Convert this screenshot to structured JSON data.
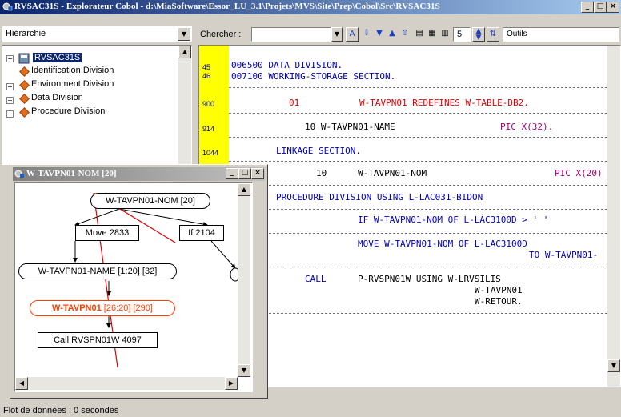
{
  "window": {
    "title": "RVSAC31S - Explorateur Cobol - d:\\MiaSoftware\\Essor_LU_3.1\\Projets\\MVS\\Site\\Prep\\Cobol\\Src\\RVSAC31S",
    "min_label": "_",
    "max_label": "□",
    "close_label": "×"
  },
  "left_panel": {
    "combo_value": "Hiérarchie",
    "tree": {
      "root": "RVSAC31S",
      "items": [
        {
          "label": "Identification Division",
          "expandable": false
        },
        {
          "label": "Environment Division",
          "expandable": true
        },
        {
          "label": "Data Division",
          "expandable": true
        },
        {
          "label": "Procedure Division",
          "expandable": true
        }
      ]
    }
  },
  "toolbar": {
    "search_label": "Chercher :",
    "search_value": "",
    "spin_value": "5",
    "tools_label": "Outils"
  },
  "code": {
    "lines": [
      {
        "ln": "45",
        "text": "006500 DATA DIVISION."
      },
      {
        "ln": "46",
        "text": "007100 WORKING-STORAGE SECTION."
      },
      {
        "ln": "900",
        "text": "01",
        "rest": "W-TAVPN01 REDEFINES W-TABLE-DB2."
      },
      {
        "ln": "914",
        "text": "10 W-TAVPN01-NAME",
        "rest": "PIC X(32)."
      },
      {
        "ln": "1044",
        "text": "LINKAGE SECTION."
      },
      {
        "ln": "",
        "text": "10",
        "rest": "W-TAVPN01-NOM",
        "pic": "PIC X(20)"
      },
      {
        "ln": "",
        "text": "PROCEDURE DIVISION USING L-LAC031-BIDON"
      },
      {
        "ln": "",
        "text": "IF W-TAVPN01-NOM OF L-LAC3100D > ' '"
      },
      {
        "ln": "",
        "text": "MOVE W-TAVPN01-NOM OF L-LAC3100D",
        "rest": "TO W-TAVPN01-"
      },
      {
        "ln": "",
        "text": "CALL",
        "rest": "P-RVSPN01W USING W-LRVSILIS",
        "extra1": "W-TAVPN01",
        "extra2": "W-RETOUR."
      }
    ]
  },
  "float_window": {
    "title": "W-TAVPN01-NOM [20]",
    "nodes": {
      "root": "W-TAVPN01-NOM [20]",
      "move": "Move 2833",
      "if": "If 2104",
      "name": "W-TAVPN01-NAME [1:20] [32]",
      "tavpn01_a": "W-TAVPN01",
      "tavpn01_b": " [26:20] [290]",
      "call": "Call RVSPN01W 4097"
    },
    "colors": {
      "highlight": "#ff4000",
      "arrow": "#e00000"
    }
  },
  "status": {
    "text": "Flot de données : 0 secondes"
  }
}
